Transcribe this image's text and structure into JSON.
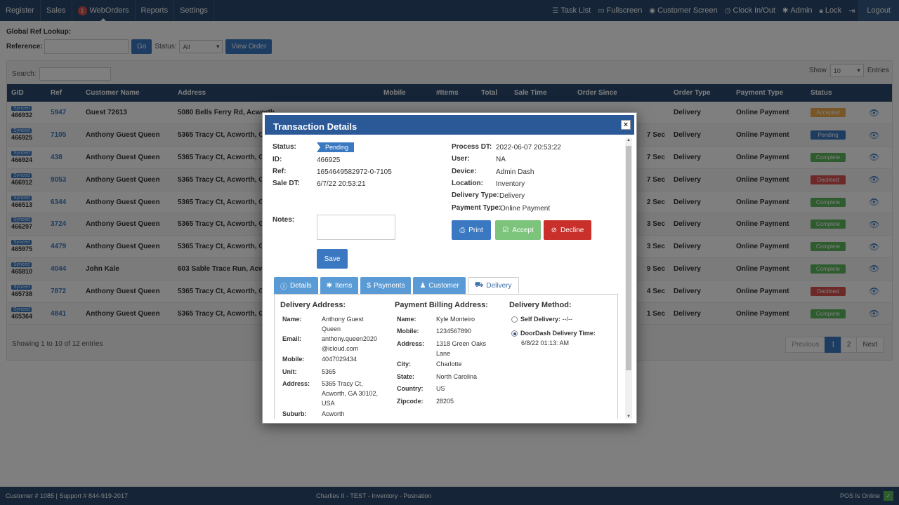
{
  "nav": {
    "left": [
      {
        "label": "Register"
      },
      {
        "label": "Sales"
      },
      {
        "label": "WebOrders",
        "badge": "1"
      },
      {
        "label": "Reports"
      },
      {
        "label": "Settings"
      }
    ],
    "right": [
      {
        "label": "Task List",
        "icon": "list-icon"
      },
      {
        "label": "Fullscreen",
        "icon": "monitor-icon"
      },
      {
        "label": "Customer Screen",
        "icon": "eye-icon"
      },
      {
        "label": "Clock In/Out",
        "icon": "clock-icon"
      },
      {
        "label": "Admin",
        "icon": "gear-icon"
      },
      {
        "label": "Lock",
        "icon": "lock-icon"
      }
    ],
    "logout": "Logout"
  },
  "lookup": {
    "title": "Global Ref Lookup:",
    "reference_label": "Reference:",
    "go": "Go",
    "status_label": "Status:",
    "status_value": "All",
    "view_order": "View Order"
  },
  "table": {
    "search_label": "Search:",
    "show_label": "Show",
    "show_value": "10",
    "entries_label": "Entries",
    "columns": [
      "GID",
      "Ref",
      "Customer Name",
      "Address",
      "Mobile",
      "#Items",
      "Total",
      "Sale Time",
      "Order Since",
      "Order Type",
      "Payment Type",
      "Status"
    ],
    "rows": [
      {
        "tag": "Synced",
        "gid": "466932",
        "ref": "5947",
        "name": "Guest 72613",
        "address": "5080 Bells Ferry Rd, Acworth",
        "since": "",
        "type": "Delivery",
        "payment": "Online Payment",
        "status": "Accepted"
      },
      {
        "tag": "Synced",
        "gid": "466925",
        "ref": "7105",
        "name": "Anthony Guest Queen",
        "address": "5365 Tracy Ct, Acworth, GA 3",
        "since": "7 Sec",
        "type": "Delivery",
        "payment": "Online Payment",
        "status": "Pending"
      },
      {
        "tag": "Synced",
        "gid": "466924",
        "ref": "438",
        "name": "Anthony Guest Queen",
        "address": "5365 Tracy Ct, Acworth, GA 3",
        "since": "7 Sec",
        "type": "Delivery",
        "payment": "Online Payment",
        "status": "Complete"
      },
      {
        "tag": "Synced",
        "gid": "466912",
        "ref": "9053",
        "name": "Anthony Guest Queen",
        "address": "5365 Tracy Ct, Acworth, GA 3",
        "since": "7 Sec",
        "type": "Delivery",
        "payment": "Online Payment",
        "status": "Declined"
      },
      {
        "tag": "Synced",
        "gid": "466513",
        "ref": "6344",
        "name": "Anthony Guest Queen",
        "address": "5365 Tracy Ct, Acworth, GA 3",
        "since": "2 Sec",
        "type": "Delivery",
        "payment": "Online Payment",
        "status": "Complete"
      },
      {
        "tag": "Synced",
        "gid": "466297",
        "ref": "3724",
        "name": "Anthony Guest Queen",
        "address": "5365 Tracy Ct, Acworth, GA 3",
        "since": "3 Sec",
        "type": "Delivery",
        "payment": "Online Payment",
        "status": "Complete"
      },
      {
        "tag": "Synced",
        "gid": "465975",
        "ref": "4479",
        "name": "Anthony Guest Queen",
        "address": "5365 Tracy Ct, Acworth, GA 3",
        "since": "3 Sec",
        "type": "Delivery",
        "payment": "Online Payment",
        "status": "Complete"
      },
      {
        "tag": "Synced",
        "gid": "465810",
        "ref": "4044",
        "name": "John Kale",
        "address": "603 Sable Trace Run, Acwort",
        "since": "9 Sec",
        "type": "Delivery",
        "payment": "Online Payment",
        "status": "Complete"
      },
      {
        "tag": "Synced",
        "gid": "465738",
        "ref": "7872",
        "name": "Anthony Guest Queen",
        "address": "5365 Tracy Ct, Acworth, GA 3",
        "since": "4 Sec",
        "type": "Delivery",
        "payment": "Online Payment",
        "status": "Declined"
      },
      {
        "tag": "Synced",
        "gid": "465364",
        "ref": "4841",
        "name": "Anthony Guest Queen",
        "address": "5365 Tracy Ct, Acworth, GA 3",
        "since": "1 Sec",
        "type": "Delivery",
        "payment": "Online Payment",
        "status": "Complete"
      }
    ],
    "showing": "Showing 1 to 10 of 12 entries",
    "pager": {
      "previous": "Previous",
      "pages": [
        "1",
        "2"
      ],
      "next": "Next"
    }
  },
  "status_colors": {
    "Accepted": "#f0ad4e",
    "Pending": "#3a78c2",
    "Complete": "#5cb85c",
    "Declined": "#d9534f"
  },
  "footer": {
    "left": "Customer # 1085 | Support # 844-919-2017",
    "center": "Charlies II - TEST - Inventory - Posnation",
    "right": "POS Is Online"
  },
  "modal": {
    "title": "Transaction Details",
    "left_fields": {
      "status_label": "Status:",
      "status_value": "Pending",
      "id_label": "ID:",
      "id_value": "466925",
      "ref_label": "Ref:",
      "ref_value": "1654649582972-0-7105",
      "sale_dt_label": "Sale DT:",
      "sale_dt_value": "6/7/22 20:53:21",
      "notes_label": "Notes:"
    },
    "right_fields": [
      {
        "label": "Process DT:",
        "value": "2022-06-07 20:53:22"
      },
      {
        "label": "User:",
        "value": "NA"
      },
      {
        "label": "Device:",
        "value": "Admin Dash"
      },
      {
        "label": "Location:",
        "value": "Inventory"
      },
      {
        "label": "Delivery Type:",
        "value": "Delivery"
      },
      {
        "label": "Payment Type:",
        "value": "Online Payment"
      }
    ],
    "buttons": {
      "save": "Save",
      "print": "Print",
      "accept": "Accept",
      "decline": "Decline"
    },
    "tabs": [
      {
        "label": "Details",
        "icon": "info-icon"
      },
      {
        "label": "Items",
        "icon": "gear-icon"
      },
      {
        "label": "Payments",
        "icon": "dollar-icon"
      },
      {
        "label": "Customer",
        "icon": "user-icon"
      },
      {
        "label": "Delivery",
        "icon": "truck-icon"
      }
    ],
    "delivery_address": {
      "title": "Delivery Address:",
      "name_label": "Name:",
      "name_value_1": "Anthony Guest",
      "name_value_2": "Queen",
      "email_label": "Email:",
      "email_value_1": "anthony.queen2020",
      "email_value_2": "@icloud.com",
      "mobile_label": "Mobile:",
      "mobile_value": "4047029434",
      "unit_label": "Unit:",
      "unit_value": "5365",
      "address_label": "Address:",
      "address_value_1": "5365 Tracy Ct,",
      "address_value_2": "Acworth, GA 30102,",
      "address_value_3": "USA",
      "suburb_label": "Suburb:",
      "suburb_value": "Acworth"
    },
    "billing_address": {
      "title": "Payment Billing Address:",
      "name_label": "Name:",
      "name_value": "Kyle Monteiro",
      "mobile_label": "Mobile:",
      "mobile_value": "1234567890",
      "address_label": "Address:",
      "address_value_1": "1318 Green Oaks",
      "address_value_2": "Lane",
      "city_label": "City:",
      "city_value": "Charlotte",
      "state_label": "State:",
      "state_value": "North Carolina",
      "country_label": "Country:",
      "country_value": "US",
      "zip_label": "Zipcode:",
      "zip_value": "28205"
    },
    "delivery_method": {
      "title": "Delivery Method:",
      "self_label": "Self Delivery:",
      "self_value": "--/--",
      "doordash_label": "DoorDash Delivery Time:",
      "doordash_value": "6/8/22 01:13: AM"
    }
  }
}
